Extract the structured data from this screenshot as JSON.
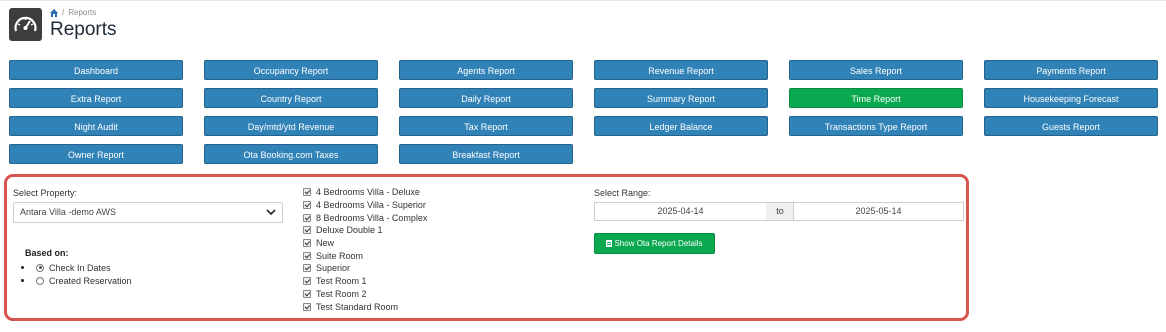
{
  "header": {
    "breadcrumb_current": "Reports",
    "title": "Reports",
    "icon": "dashboard-gauge-icon"
  },
  "report_buttons": [
    [
      "Dashboard",
      "Occupancy Report",
      "Agents Report",
      "Revenue Report",
      "Sales Report",
      "Payments Report"
    ],
    [
      "Extra Report",
      "Country Report",
      "Daily Report",
      "Summary Report",
      "Time Report",
      "Housekeeping Forecast"
    ],
    [
      "Night Audit",
      "Day/mtd/ytd Revenue",
      "Tax Report",
      "Ledger Balance",
      "Transactions Type Report",
      "Guests Report"
    ],
    [
      "Owner Report",
      "Ota Booking.com Taxes",
      "Breakfast Report"
    ]
  ],
  "active_report": "Time Report",
  "colors": {
    "button_blue": "#3082b7",
    "button_active_green": "#0aa84f",
    "panel_border_red": "#d9534f"
  },
  "filters": {
    "property_label": "Select Property:",
    "property_value": "Antara Villa -demo AWS",
    "based_on_label": "Based on:",
    "based_on_options": [
      {
        "label": "Check In Dates",
        "selected": true
      },
      {
        "label": "Created Reservation",
        "selected": false
      }
    ],
    "room_types": [
      "4 Bedrooms Villa - Deluxe",
      "4 Bedrooms Villa - Superior",
      "8 Bedrooms Villa - Complex",
      "Deluxe Double 1",
      "New",
      "Suite Room",
      "Superior",
      "Test Room 1",
      "Test Room 2",
      "Test Standard Room"
    ],
    "range_label": "Select Range:",
    "range_from": "2025-04-14",
    "range_to_label": "to",
    "range_to": "2025-05-14",
    "show_button_label": "Show Ota Report Details"
  }
}
